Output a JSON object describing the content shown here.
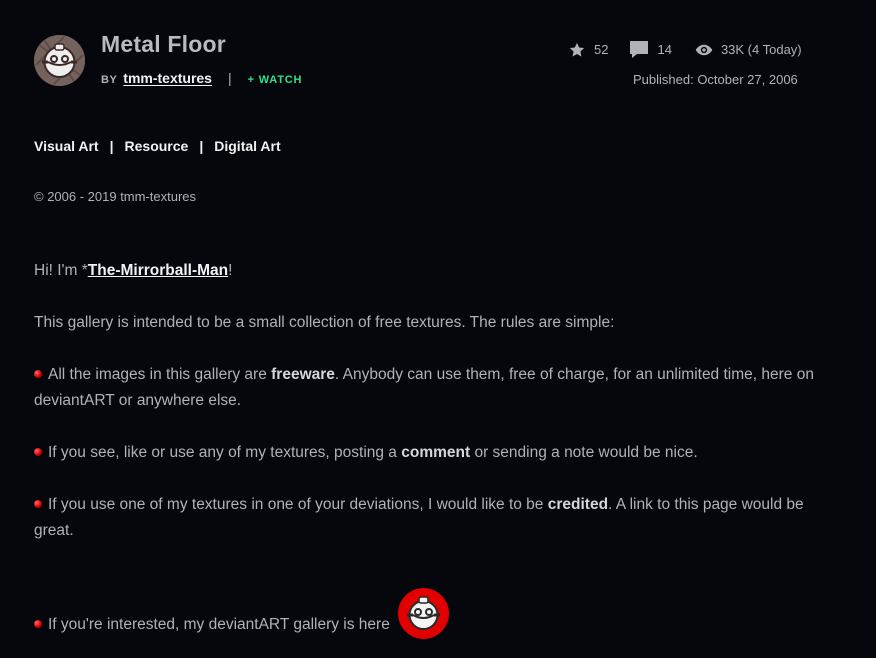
{
  "deviation": {
    "title": "Metal Floor",
    "by_label": "BY",
    "author": "tmm-textures",
    "separator": "|",
    "watch_label": "+ WATCH",
    "stats": {
      "favorites": "52",
      "comments": "14",
      "views": "33K (4 Today)"
    },
    "published": "Published: October 27, 2006"
  },
  "categories": [
    "Visual Art",
    "Resource",
    "Digital Art"
  ],
  "category_separator": "|",
  "copyright": "© 2006 - 2019 tmm-textures",
  "description": {
    "greeting_prefix": "Hi! I'm *",
    "greeting_link": "The-Mirrorball-Man",
    "greeting_suffix": "!",
    "intro": "This gallery is intended to be a small collection of free textures. The rules are simple:",
    "rule1_before": "All the images in this gallery are ",
    "rule1_strong": "freeware",
    "rule1_after": ". Anybody can use them, free of charge, for an unlimited time, here on deviantART or anywhere else.",
    "rule2_before": "If you see, like or use any of my textures, posting a ",
    "rule2_strong": "comment",
    "rule2_after": " or sending a note would be nice.",
    "rule3_before": "If you use one of my textures in one of your deviations, I would like to be ",
    "rule3_strong": "credited",
    "rule3_after": ". A link to this page would be great.",
    "rule4": "If you're interested, my deviantART gallery is here"
  },
  "colors": {
    "background": "#06070d",
    "accent_watch": "#2ae48a",
    "bullet_red": "#d10000",
    "text": "#b1b1b9",
    "text_bright": "#f2f2f4"
  },
  "icons": {
    "favorites": "star-icon",
    "comments": "comment-icon",
    "views": "eye-icon",
    "bullet": "red-dot-icon",
    "gallery_logo": "mirrorball-man-logo"
  }
}
